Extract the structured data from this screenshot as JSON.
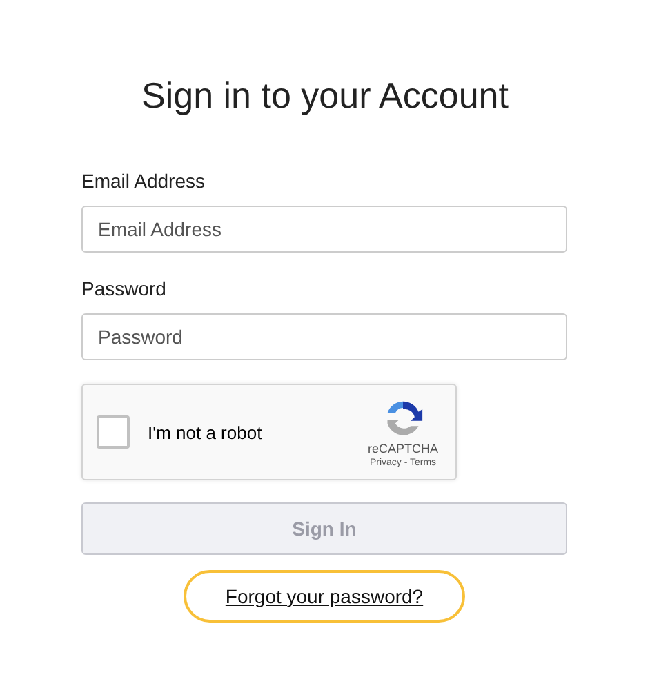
{
  "title": "Sign in to your Account",
  "fields": [
    {
      "label": "Email Address",
      "placeholder": "Email Address"
    },
    {
      "label": "Password",
      "placeholder": "Password"
    }
  ],
  "captcha": {
    "label": "I'm not a robot",
    "checked": false,
    "brand": "reCAPTCHA",
    "links": "Privacy - Terms"
  },
  "submit": {
    "label": "Sign In",
    "disabled": true
  },
  "forgot_link": {
    "label": "Forgot your password?",
    "focused": true
  }
}
